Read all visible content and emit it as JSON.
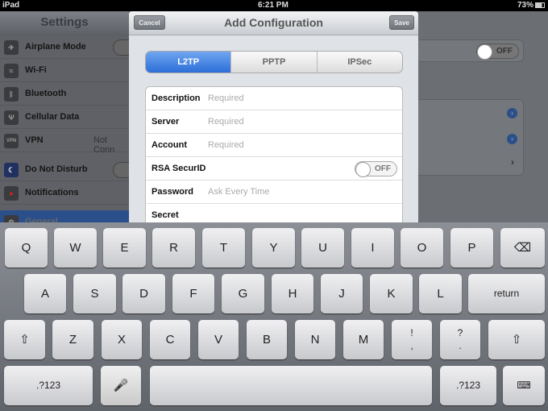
{
  "status": {
    "device": "iPad",
    "time": "6:21 PM",
    "battery": "73%"
  },
  "sidebar": {
    "title": "Settings",
    "items": [
      {
        "label": "Airplane Mode",
        "icon": "airplane-icon",
        "toggle": true
      },
      {
        "label": "Wi-Fi",
        "icon": "wifi-icon"
      },
      {
        "label": "Bluetooth",
        "icon": "bluetooth-icon"
      },
      {
        "label": "Cellular Data",
        "icon": "cellular-icon"
      },
      {
        "label": "VPN",
        "icon": "vpn-icon",
        "value": "Not Conn"
      },
      {
        "label": "Do Not Disturb",
        "icon": "moon-icon",
        "toggle": true
      },
      {
        "label": "Notifications",
        "icon": "notifications-icon"
      },
      {
        "label": "General",
        "icon": "gear-icon"
      }
    ]
  },
  "background": {
    "toggle": "OFF"
  },
  "modal": {
    "title": "Add Configuration",
    "cancel": "Cancel",
    "save": "Save",
    "tabs": [
      "L2TP",
      "PPTP",
      "IPSec"
    ],
    "selected_tab": "L2TP",
    "fields": [
      {
        "label": "Description",
        "placeholder": "Required"
      },
      {
        "label": "Server",
        "placeholder": "Required"
      },
      {
        "label": "Account",
        "placeholder": "Required"
      },
      {
        "label": "RSA SecurID",
        "toggle": "OFF"
      },
      {
        "label": "Password",
        "placeholder": "Ask Every Time"
      },
      {
        "label": "Secret",
        "placeholder": ""
      }
    ]
  },
  "keyboard": {
    "row1": [
      "Q",
      "W",
      "E",
      "R",
      "T",
      "Y",
      "U",
      "I",
      "O",
      "P",
      "⌫"
    ],
    "row2": [
      "A",
      "S",
      "D",
      "F",
      "G",
      "H",
      "J",
      "K",
      "L",
      "return"
    ],
    "row3": [
      "⇧",
      "Z",
      "X",
      "C",
      "V",
      "B",
      "N",
      "M",
      "!\n,",
      "?\n.",
      "⇧"
    ],
    "row4": [
      ".?123",
      "🎤",
      "",
      " .?123",
      "⌨"
    ]
  },
  "colors": {
    "accent": "#2c6ed8"
  }
}
